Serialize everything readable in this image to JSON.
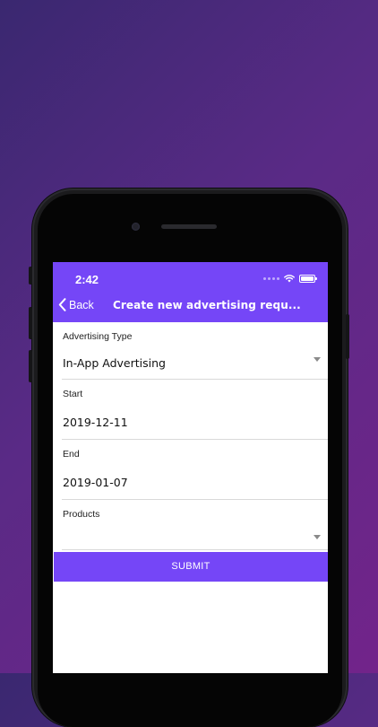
{
  "status_bar": {
    "time": "2:42"
  },
  "nav": {
    "back_label": "Back",
    "title": "Create new advertising requ..."
  },
  "form": {
    "advertising_type": {
      "label": "Advertising Type",
      "value": "In-App Advertising"
    },
    "start": {
      "label": "Start",
      "value": "2019-12-11"
    },
    "end": {
      "label": "End",
      "value": "2019-01-07"
    },
    "products": {
      "label": "Products",
      "value": ""
    }
  },
  "submit_label": "SUBMIT",
  "colors": {
    "accent": "#7546f7",
    "background_gradient_start": "#3a2870",
    "background_gradient_end": "#72248a"
  }
}
